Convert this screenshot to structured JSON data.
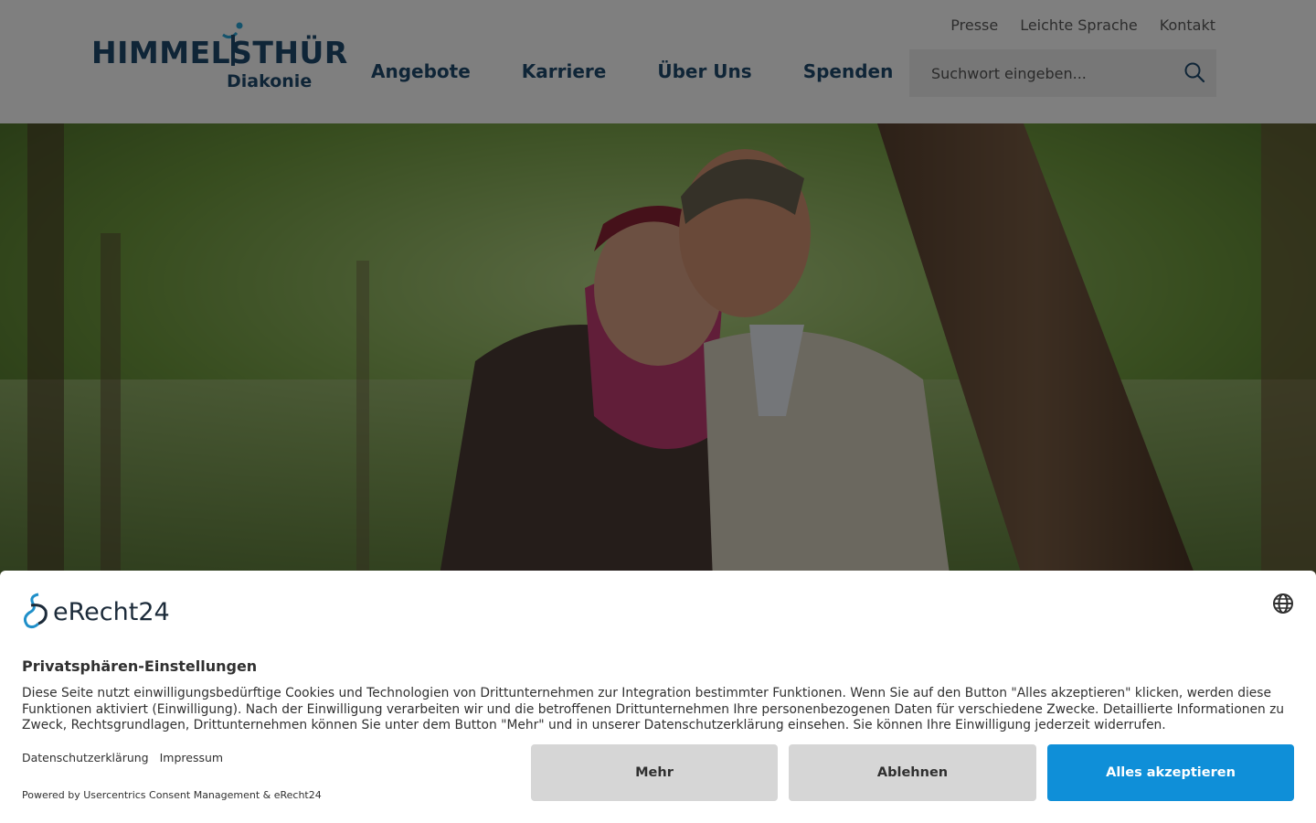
{
  "header": {
    "logo_main": "HIMMELSTHÜR",
    "logo_sub": "Diakonie",
    "main_nav": [
      "Angebote",
      "Karriere",
      "Über Uns",
      "Spenden"
    ],
    "top_links": [
      "Presse",
      "Leichte Sprache",
      "Kontakt"
    ],
    "search_placeholder": "Suchwort eingeben...",
    "search_icon": "search-icon"
  },
  "hero": {
    "image": "couple-in-park-photo"
  },
  "consent": {
    "brand": "eRecht24",
    "title": "Privatsphären-Einstellungen",
    "text": "Diese Seite nutzt einwilligungsbedürftige Cookies und Technologien von Drittunternehmen zur Integration bestimmter Funktionen. Wenn Sie auf den Button \"Alles akzeptieren\" klicken, werden diese Funktionen aktiviert (Einwilligung). Nach der Einwilligung verarbeiten wir und die betroffenen Drittunternehmen Ihre personenbezogenen Daten für verschiedene Zwecke. Detaillierte Informationen zu Zweck, Rechtsgrundlagen, Drittunternehmen können Sie unter dem Button \"Mehr\" und in unserer Datenschutzerklärung einsehen. Sie können Ihre Einwilligung jederzeit widerrufen.",
    "links": [
      "Datenschutzerklärung",
      "Impressum"
    ],
    "powered_by": "Powered by Usercentrics Consent Management & eRecht24",
    "buttons": {
      "more": "Mehr",
      "deny": "Ablehnen",
      "accept": "Alles akzeptieren"
    },
    "language_icon": "globe-icon"
  },
  "colors": {
    "brand_blue": "#1f4a6e",
    "accept_blue": "#0f8fd8",
    "button_gray": "#d6d6d6"
  }
}
